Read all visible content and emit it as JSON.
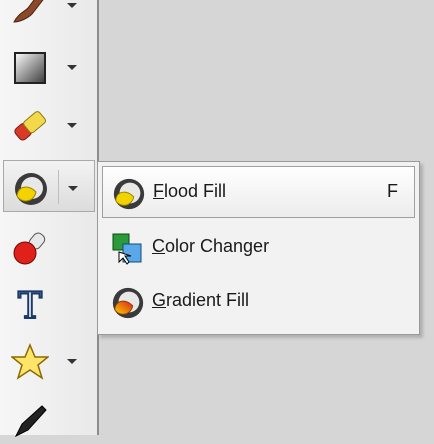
{
  "toolbar": {
    "tools": [
      {
        "icon": "brush-icon",
        "has_dropdown": true
      },
      {
        "icon": "gradient-rectangle-icon",
        "has_dropdown": true
      },
      {
        "icon": "eraser-icon",
        "has_dropdown": true
      },
      {
        "icon": "flood-fill-icon",
        "has_dropdown": true,
        "active": true
      },
      {
        "icon": "color-picker-icon",
        "has_dropdown": false
      },
      {
        "icon": "text-tool-icon",
        "has_dropdown": false
      },
      {
        "icon": "star-shape-icon",
        "has_dropdown": true
      },
      {
        "icon": "pen-icon",
        "has_dropdown": false
      }
    ]
  },
  "menu": {
    "items": [
      {
        "mnemonic": "F",
        "rest": "lood Fill",
        "shortcut": "F",
        "icon": "flood-fill-icon",
        "highlighted": true
      },
      {
        "mnemonic": "C",
        "rest": "olor Changer",
        "shortcut": "",
        "icon": "color-changer-icon",
        "highlighted": false
      },
      {
        "mnemonic": "G",
        "rest": "radient Fill",
        "shortcut": "",
        "icon": "gradient-fill-icon",
        "highlighted": false
      }
    ]
  },
  "colors": {
    "toolbar_bg": "#efefef",
    "canvas_bg": "#d6d6d6",
    "menu_bg": "#f2f2f2",
    "fill_yellow": "#f2d300",
    "fill_red": "#e0201a"
  }
}
